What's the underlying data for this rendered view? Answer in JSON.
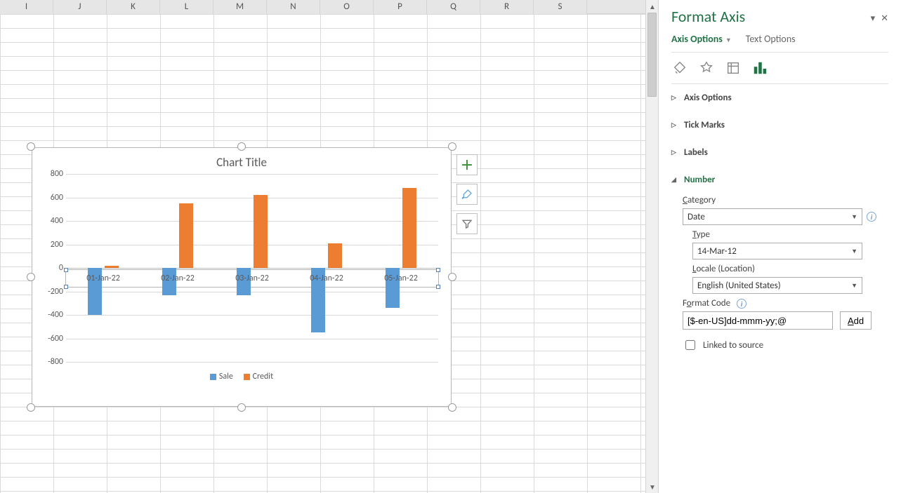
{
  "spreadsheet": {
    "columns": [
      "I",
      "J",
      "K",
      "L",
      "M",
      "N",
      "O",
      "P",
      "Q",
      "R",
      "S"
    ]
  },
  "chart_data": {
    "type": "bar",
    "title": "Chart Title",
    "categories": [
      "01-Jan-22",
      "02-Jan-22",
      "03-Jan-22",
      "04-Jan-22",
      "05-Jan-22"
    ],
    "series": [
      {
        "name": "Sale",
        "values": [
          -400,
          -230,
          -230,
          -550,
          -340
        ],
        "color": "#5B9BD5"
      },
      {
        "name": "Credit",
        "values": [
          20,
          550,
          620,
          210,
          680
        ],
        "color": "#ED7D31"
      }
    ],
    "ylabel": "",
    "xlabel": "",
    "ylim": [
      -800,
      800
    ],
    "yticks": [
      800,
      600,
      400,
      200,
      0,
      -200,
      -400,
      -600,
      -800
    ]
  },
  "chart_buttons": {
    "add": "+",
    "brush": "brush",
    "filter": "filter"
  },
  "format_pane": {
    "title": "Format Axis",
    "tabs": {
      "axis_options": "Axis Options",
      "text_options": "Text Options"
    },
    "icon_tabs": [
      "fill-icon",
      "effects-icon",
      "size-icon",
      "bar-chart-icon"
    ],
    "sections": {
      "axis_options": "Axis Options",
      "tick_marks": "Tick Marks",
      "labels": "Labels",
      "number": "Number"
    },
    "number": {
      "category_label": "Category",
      "category_value": "Date",
      "type_label": "Type",
      "type_value": "14-Mar-12",
      "locale_label": "Locale (Location)",
      "locale_value": "English (United States)",
      "format_code_label": "Format Code",
      "format_code_value": "[$-en-US]dd-mmm-yy;@",
      "add_button": "Add",
      "linked_label": "Linked to source",
      "linked_checked": false
    }
  }
}
